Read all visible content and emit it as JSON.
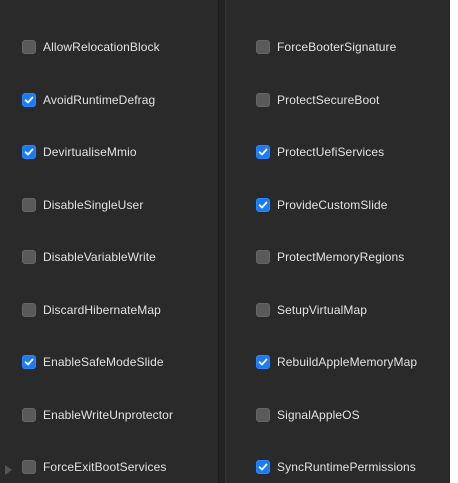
{
  "left_column": [
    {
      "label": "AllowRelocationBlock",
      "checked": false
    },
    {
      "label": "AvoidRuntimeDefrag",
      "checked": true
    },
    {
      "label": "DevirtualiseMmio",
      "checked": true
    },
    {
      "label": "DisableSingleUser",
      "checked": false
    },
    {
      "label": "DisableVariableWrite",
      "checked": false
    },
    {
      "label": "DiscardHibernateMap",
      "checked": false
    },
    {
      "label": "EnableSafeModeSlide",
      "checked": true
    },
    {
      "label": "EnableWriteUnprotector",
      "checked": false
    },
    {
      "label": "ForceExitBootServices",
      "checked": false
    }
  ],
  "right_column": [
    {
      "label": "ForceBooterSignature",
      "checked": false
    },
    {
      "label": "ProtectSecureBoot",
      "checked": false
    },
    {
      "label": "ProtectUefiServices",
      "checked": true
    },
    {
      "label": "ProvideCustomSlide",
      "checked": true
    },
    {
      "label": "ProtectMemoryRegions",
      "checked": false
    },
    {
      "label": "SetupVirtualMap",
      "checked": false
    },
    {
      "label": "RebuildAppleMemoryMap",
      "checked": true
    },
    {
      "label": "SignalAppleOS",
      "checked": false
    },
    {
      "label": "SyncRuntimePermissions",
      "checked": true
    }
  ],
  "colors": {
    "panel_background": "#2a2a2a",
    "checkbox_on": "#1a7cf5",
    "checkbox_off": "#5a5a5a",
    "label_text": "#e2e2e2"
  },
  "icons": {
    "checked": "checkmark-icon"
  }
}
